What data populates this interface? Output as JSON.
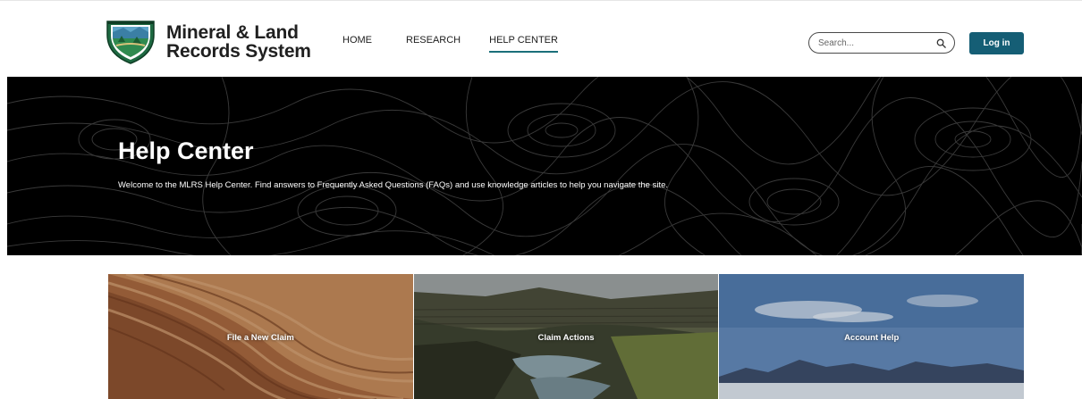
{
  "header": {
    "logo": {
      "line1": "Mineral & Land",
      "line2": "Records System"
    },
    "nav": {
      "home": "HOME",
      "research": "RESEARCH",
      "help_center": "HELP CENTER"
    },
    "search": {
      "placeholder": "Search..."
    },
    "login_label": "Log in"
  },
  "hero": {
    "title": "Help Center",
    "subtitle": "Welcome to the MLRS Help Center. Find answers to Frequently Asked Questions (FAQs) and use knowledge articles to help you navigate the site."
  },
  "tiles": [
    {
      "label": "File a New Claim"
    },
    {
      "label": "Claim Actions"
    },
    {
      "label": "Account Help"
    }
  ],
  "colors": {
    "accent": "#155e75",
    "nav_underline": "#1b6f7a",
    "hero_bg": "#000000"
  }
}
